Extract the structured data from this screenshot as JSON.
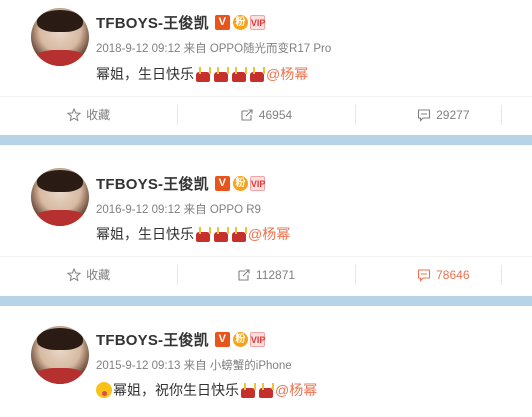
{
  "posts": [
    {
      "author": "TFBOYS-王俊凯",
      "badges": {
        "verified": "V",
        "fan": "粉",
        "vip": "VIP"
      },
      "timestamp": "2018-9-12 09:12",
      "source_prefix": "来自",
      "source": "OPPO随光而变R17 Pro",
      "text": "幂姐，生日快乐",
      "emoji": [
        "cake-icon",
        "cake-icon",
        "cake-icon",
        "cake-icon"
      ],
      "mention": "@杨幂",
      "actions": {
        "favorite": "收藏",
        "repost": "46954",
        "comment": "29277"
      }
    },
    {
      "author": "TFBOYS-王俊凯",
      "badges": {
        "verified": "V",
        "fan": "粉",
        "vip": "VIP"
      },
      "timestamp": "2016-9-12 09:12",
      "source_prefix": "来自",
      "source": "OPPO R9",
      "text": "幂姐，生日快乐",
      "emoji": [
        "cake-icon",
        "cake-icon",
        "cake-icon"
      ],
      "mention": "@杨幂",
      "actions": {
        "favorite": "收藏",
        "repost": "112871",
        "comment": "78646"
      }
    },
    {
      "author": "TFBOYS-王俊凯",
      "badges": {
        "verified": "V",
        "fan": "粉",
        "vip": "VIP"
      },
      "timestamp": "2015-9-12 09:13",
      "source_prefix": "来自",
      "source": "小螃蟹的iPhone",
      "text": "幂姐，祝你生日快乐",
      "emoji": [
        "cake-icon",
        "cake-icon"
      ],
      "mention": "@杨幂"
    }
  ],
  "colors": {
    "accent": "#eb7350",
    "separator": "#b7d3e8",
    "muted": "#808080"
  }
}
